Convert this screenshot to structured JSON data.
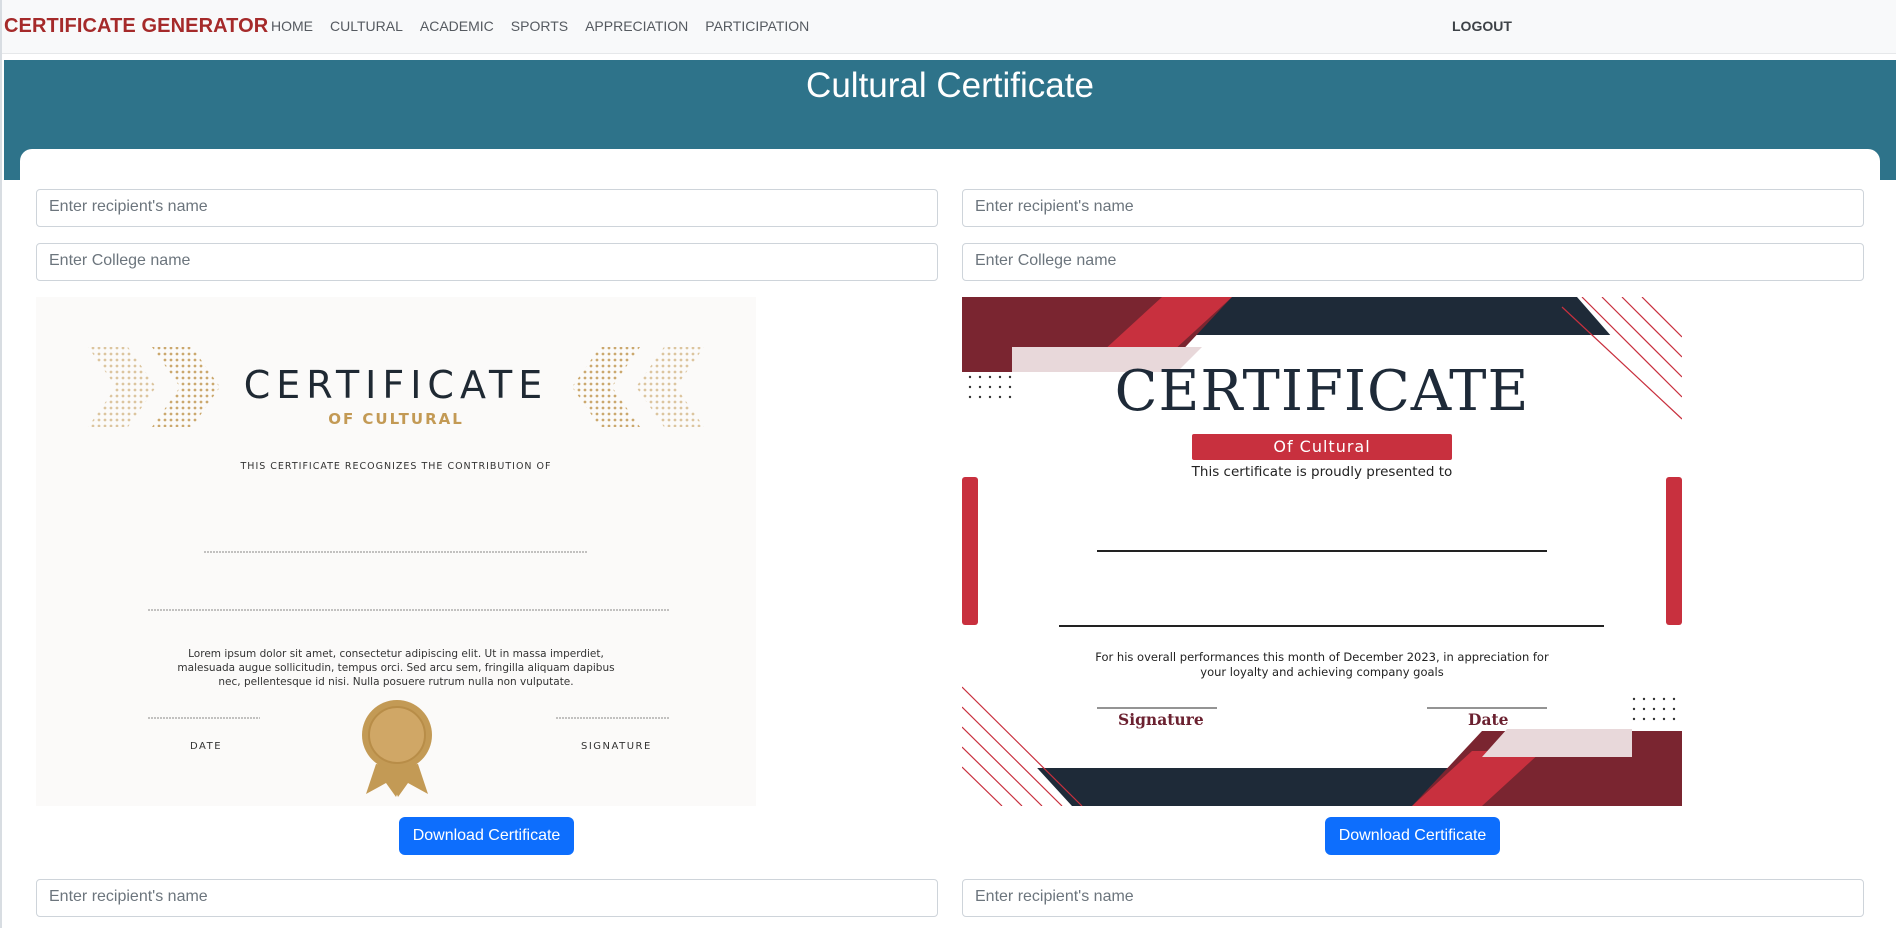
{
  "navbar": {
    "brand": "CERTIFICATE GENERATOR",
    "links": [
      "HOME",
      "CULTURAL",
      "ACADEMIC",
      "SPORTS",
      "APPRECIATION",
      "PARTICIPATION"
    ],
    "logout": "LOGOUT"
  },
  "page": {
    "title": "Cultural Certificate"
  },
  "form": {
    "recipient_placeholder": "Enter recipient's name",
    "college_placeholder": "Enter College name",
    "download_label": "Download Certificate"
  },
  "cert1": {
    "title": "CERTIFICATE",
    "subtitle": "OF CULTURAL",
    "recognizes": "THIS CERTIFICATE RECOGNIZES THE CONTRIBUTION OF",
    "body": "Lorem ipsum dolor sit amet, consectetur adipiscing elit. Ut in massa imperdiet, malesuada augue sollicitudin, tempus orci. Sed arcu sem, fringilla aliquam dapibus nec, pellentesque id nisi. Nulla posuere rutrum nulla non vulputate.",
    "date_label": "DATE",
    "signature_label": "SIGNATURE",
    "colors": {
      "gold": "#c39a55",
      "dark": "#1f2933"
    }
  },
  "cert2": {
    "title": "CERTIFICATE",
    "subtitle": "Of Cultural",
    "presented": "This certificate is proudly presented to",
    "body": "For his overall performances this month of December 2023, in appreciation for your loyalty and achieving company goals",
    "signature_label": "Signature",
    "date_label": "Date",
    "colors": {
      "red": "#c8303e",
      "navy": "#1e2a38",
      "maroon": "#7a2530"
    }
  },
  "colors": {
    "band": "#2e738a",
    "brand": "#a52a2a",
    "button": "#0d6efd"
  }
}
